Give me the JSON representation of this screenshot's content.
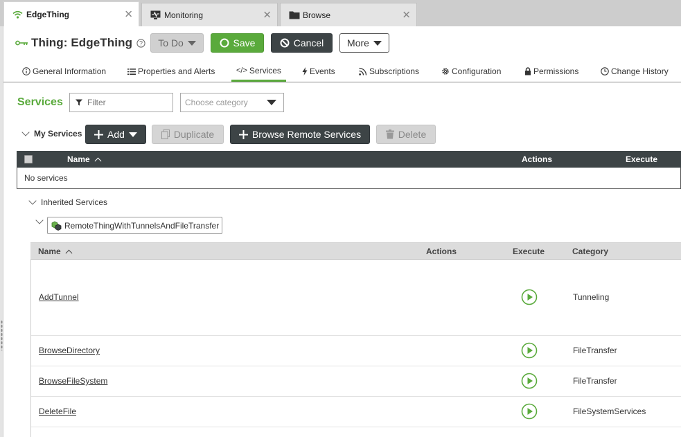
{
  "tabs": [
    {
      "label": "EdgeThing",
      "icon": "wifi-icon",
      "active": true
    },
    {
      "label": "Monitoring",
      "icon": "monitor-icon",
      "active": false
    },
    {
      "label": "Browse",
      "icon": "folder-icon",
      "active": false
    }
  ],
  "header": {
    "title": "Thing: EdgeThing",
    "status_button": "To Do",
    "save_label": "Save",
    "cancel_label": "Cancel",
    "more_label": "More"
  },
  "nav": [
    {
      "label": "General Information",
      "icon": "info-icon"
    },
    {
      "label": "Properties and Alerts",
      "icon": "list-icon"
    },
    {
      "label": "Services",
      "icon": "code-icon",
      "active": true
    },
    {
      "label": "Events",
      "icon": "lightning-icon"
    },
    {
      "label": "Subscriptions",
      "icon": "rss-icon"
    },
    {
      "label": "Configuration",
      "icon": "gear-icon"
    },
    {
      "label": "Permissions",
      "icon": "lock-icon"
    },
    {
      "label": "Change History",
      "icon": "clock-icon"
    }
  ],
  "services": {
    "heading": "Services",
    "filter_placeholder": "Filter",
    "category_placeholder": "Choose category",
    "my_services_label": "My Services",
    "add_label": "Add",
    "duplicate_label": "Duplicate",
    "browse_remote_label": "Browse Remote Services",
    "delete_label": "Delete",
    "my_table": {
      "col_name": "Name",
      "col_actions": "Actions",
      "col_execute": "Execute",
      "empty_text": "No services"
    },
    "inherited_label": "Inherited Services",
    "parent_template": "RemoteThingWithTunnelsAndFileTransfer",
    "inherited_table": {
      "col_name": "Name",
      "col_actions": "Actions",
      "col_execute": "Execute",
      "col_category": "Category",
      "rows": [
        {
          "name": "AddTunnel",
          "category": "Tunneling"
        },
        {
          "name": "BrowseDirectory",
          "category": "FileTransfer"
        },
        {
          "name": "BrowseFileSystem",
          "category": "FileTransfer"
        },
        {
          "name": "DeleteFile",
          "category": "FileSystemServices"
        }
      ]
    }
  },
  "colors": {
    "accent_green": "#5aaa3c",
    "dark_button": "#3d4446",
    "disabled_button": "#d5d5d5"
  }
}
